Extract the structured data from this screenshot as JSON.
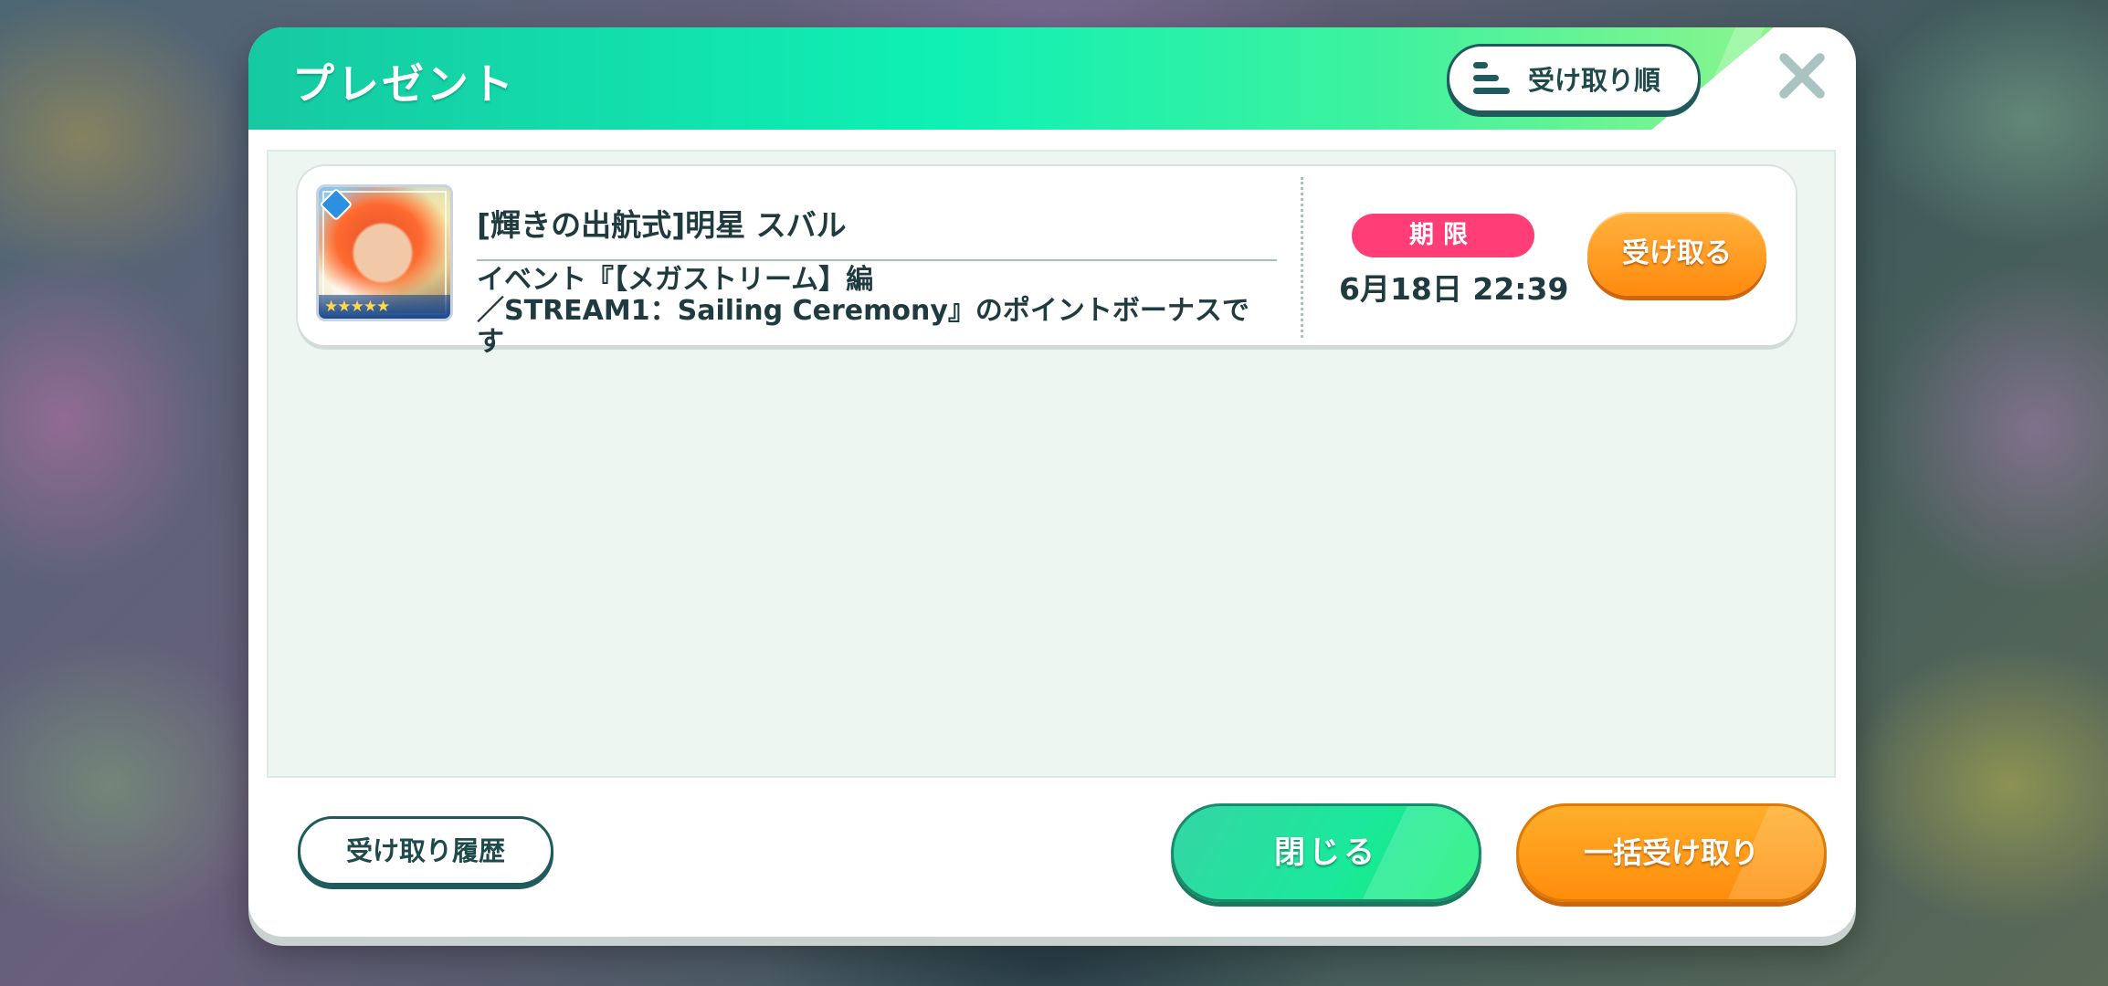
{
  "dialog": {
    "title": "プレゼント",
    "sort_label": "受け取り順",
    "close_icon": "close-icon"
  },
  "presents": [
    {
      "title": "[輝きの出航式]明星 スバル",
      "description_lines": [
        "イベント『【メガストリーム】編",
        "／STREAM1：Sailing Ceremony』のポイントボーナスで",
        "す"
      ],
      "rarity_stars": "★★★★★",
      "deadline_label": "期限",
      "deadline": "6月18日 22:39",
      "receive_label": "受け取る"
    }
  ],
  "footer": {
    "history_label": "受け取り履歴",
    "close_label": "閉じる",
    "bulk_receive_label": "一括受け取り"
  },
  "colors": {
    "header_gradient_start": "#16c9a2",
    "header_gradient_end": "#8cf58c",
    "deadline_badge": "#ff3e77",
    "orange_button": "#ff8a0e",
    "green_button": "#1be89c",
    "text_dark": "#1f3b40"
  }
}
